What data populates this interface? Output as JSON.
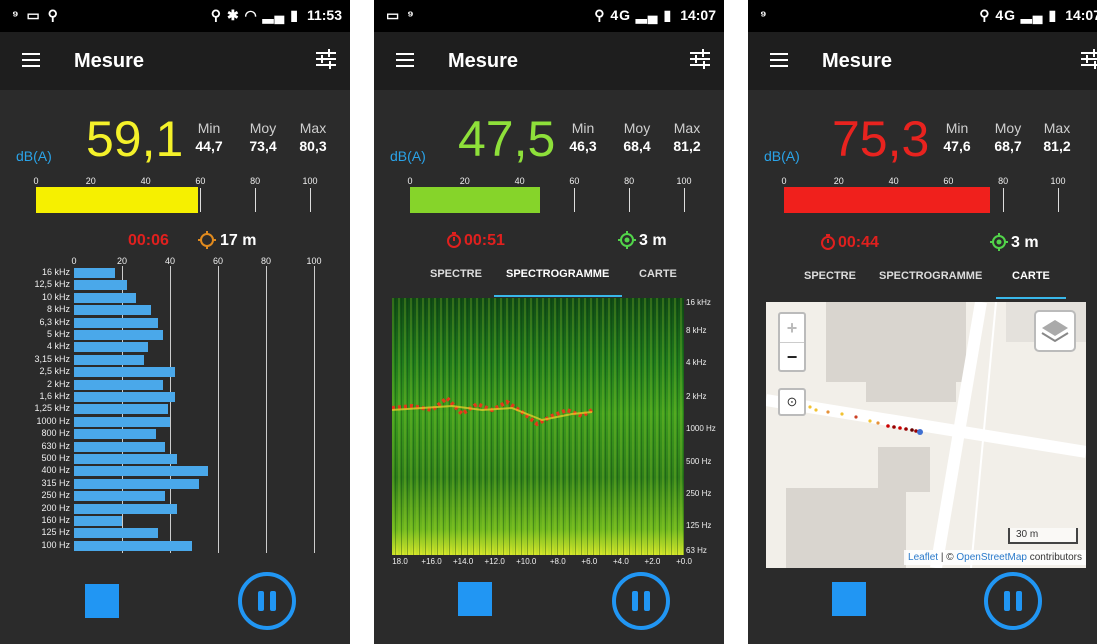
{
  "screens": [
    {
      "status": {
        "left_icons": "⁹ ▭ ⚲",
        "signal_icons": "⚲ ✱ ◠ ▂▄ ▮",
        "time": "11:53"
      },
      "title": "Mesure",
      "unit": "dB(A)",
      "value": "59,1",
      "value_color": "#f4f12a",
      "min": {
        "label": "Min",
        "value": "44,7"
      },
      "moy": {
        "label": "Moy",
        "value": "73,4"
      },
      "max": {
        "label": "Max",
        "value": "80,3"
      },
      "scale_ticks": [
        "0",
        "20",
        "40",
        "60",
        "80",
        "100"
      ],
      "level_fraction": 0.59,
      "level_color": "#f6f000",
      "timer": "00:06",
      "gps_accuracy": "17 m",
      "gps_color": "#e08a1e",
      "view": "spectre"
    },
    {
      "status": {
        "left_icons": "▭ ⁹",
        "signal_icons": "⚲ 4G ▂▄ ▮",
        "time": "14:07"
      },
      "title": "Mesure",
      "unit": "dB(A)",
      "value": "47,5",
      "value_color": "#8ee03a",
      "min": {
        "label": "Min",
        "value": "46,3"
      },
      "moy": {
        "label": "Moy",
        "value": "68,4"
      },
      "max": {
        "label": "Max",
        "value": "81,2"
      },
      "scale_ticks": [
        "0",
        "20",
        "40",
        "60",
        "80",
        "100"
      ],
      "level_fraction": 0.475,
      "level_color": "#86d42a",
      "timer": "00:51",
      "gps_accuracy": "3 m",
      "gps_color": "#52d44a",
      "tabs": [
        "SPECTRE",
        "SPECTROGRAMME",
        "CARTE"
      ],
      "active_tab": 1,
      "view": "spectrogram"
    },
    {
      "status": {
        "left_icons": "⁹",
        "signal_icons": "⚲ 4G ▂▄ ▮",
        "time": "14:07"
      },
      "title": "Mesure",
      "unit": "dB(A)",
      "value": "75,3",
      "value_color": "#e8231f",
      "min": {
        "label": "Min",
        "value": "47,6"
      },
      "moy": {
        "label": "Moy",
        "value": "68,7"
      },
      "max": {
        "label": "Max",
        "value": "81,2"
      },
      "scale_ticks": [
        "0",
        "20",
        "40",
        "60",
        "80",
        "100"
      ],
      "level_fraction": 0.753,
      "level_color": "#f0201c",
      "timer": "00:44",
      "gps_accuracy": "3 m",
      "gps_color": "#52d44a",
      "tabs": [
        "SPECTRE",
        "SPECTROGRAMME",
        "CARTE"
      ],
      "active_tab": 2,
      "view": "map",
      "map": {
        "scale_label": "30 m",
        "attribution_leaflet": "Leaflet",
        "attribution_sep": " | © ",
        "attribution_osm": "OpenStreetMap",
        "attribution_rest": " contributors"
      }
    }
  ],
  "spectrum": {
    "axis_ticks": [
      "0",
      "20",
      "40",
      "60",
      "80",
      "100"
    ],
    "bands": [
      {
        "label": "16 kHz",
        "value": 17
      },
      {
        "label": "12,5 kHz",
        "value": 22
      },
      {
        "label": "10 kHz",
        "value": 26
      },
      {
        "label": "8 kHz",
        "value": 32
      },
      {
        "label": "6,3 kHz",
        "value": 35
      },
      {
        "label": "5 kHz",
        "value": 37
      },
      {
        "label": "4 kHz",
        "value": 31
      },
      {
        "label": "3,15 kHz",
        "value": 29
      },
      {
        "label": "2,5 kHz",
        "value": 42
      },
      {
        "label": "2 kHz",
        "value": 37
      },
      {
        "label": "1,6 kHz",
        "value": 42
      },
      {
        "label": "1,25 kHz",
        "value": 39
      },
      {
        "label": "1000 Hz",
        "value": 40
      },
      {
        "label": "800 Hz",
        "value": 34
      },
      {
        "label": "630 Hz",
        "value": 38
      },
      {
        "label": "500 Hz",
        "value": 43
      },
      {
        "label": "400 Hz",
        "value": 56
      },
      {
        "label": "315 Hz",
        "value": 52
      },
      {
        "label": "250 Hz",
        "value": 38
      },
      {
        "label": "200 Hz",
        "value": 43
      },
      {
        "label": "160 Hz",
        "value": 20
      },
      {
        "label": "125 Hz",
        "value": 35
      },
      {
        "label": "100 Hz",
        "value": 49
      }
    ]
  },
  "spectrogram": {
    "freq_labels": [
      "16 kHz",
      "8 kHz",
      "4 kHz",
      "2 kHz",
      "1000 Hz",
      "500 Hz",
      "250 Hz",
      "125 Hz",
      "63 Hz"
    ],
    "time_labels": [
      "18.0",
      "+16.0",
      "+14.0",
      "+12.0",
      "+10.0",
      "+8.0",
      "+6.0",
      "+4.0",
      "+2.0",
      "+0.0"
    ]
  }
}
